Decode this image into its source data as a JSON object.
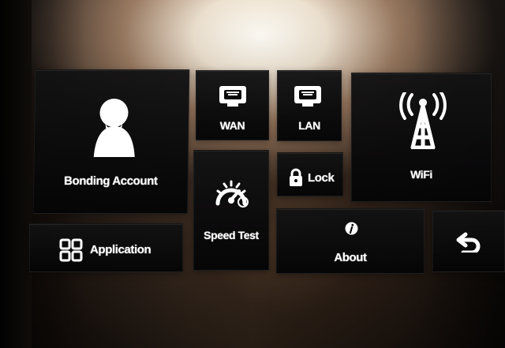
{
  "tiles": {
    "bonding_account": {
      "label": "Bonding Account",
      "icon": "user-icon"
    },
    "application": {
      "label": "Application",
      "icon": "apps-grid-icon"
    },
    "wan": {
      "label": "WAN",
      "icon": "ethernet-port-icon"
    },
    "lan": {
      "label": "LAN",
      "icon": "ethernet-port-icon"
    },
    "speed_test": {
      "label": "Speed Test",
      "icon": "speedometer-icon"
    },
    "lock": {
      "label": "Lock",
      "icon": "lock-icon"
    },
    "wifi": {
      "label": "WiFi",
      "icon": "wifi-antenna-icon"
    },
    "about": {
      "label": "About",
      "icon": "info-icon"
    },
    "back": {
      "label": "",
      "icon": "back-arrow-icon"
    }
  },
  "colors": {
    "tile_background": "#050506",
    "text": "#ffffff"
  }
}
